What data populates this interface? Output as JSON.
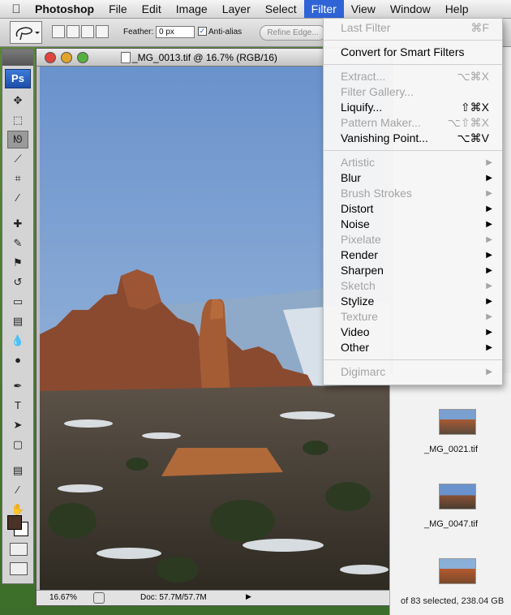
{
  "menubar": {
    "apple": "",
    "app_name": "Photoshop",
    "items": [
      "File",
      "Edit",
      "Image",
      "Layer",
      "Select",
      "Filter",
      "View",
      "Window",
      "Help"
    ],
    "active": "Filter"
  },
  "options_bar": {
    "feather_label": "Feather:",
    "feather_value": "0 px",
    "antialias_label": "Anti-alias",
    "antialias_checked": true,
    "refine_edge_label": "Refine Edge..."
  },
  "tools": {
    "logo": "Ps",
    "items": [
      {
        "name": "move-tool",
        "glyph": "✥"
      },
      {
        "name": "marquee-tool",
        "glyph": "⬚"
      },
      {
        "name": "lasso-tool",
        "glyph": "ᘚ",
        "selected": true
      },
      {
        "name": "quick-selection-tool",
        "glyph": "⟋"
      },
      {
        "name": "crop-tool",
        "glyph": "⌗"
      },
      {
        "name": "eyedropper-tool",
        "glyph": "⁄"
      },
      {
        "name": "healing-brush-tool",
        "glyph": "✚"
      },
      {
        "name": "brush-tool",
        "glyph": "✎"
      },
      {
        "name": "clone-stamp-tool",
        "glyph": "⚑"
      },
      {
        "name": "history-brush-tool",
        "glyph": "↺"
      },
      {
        "name": "eraser-tool",
        "glyph": "▭"
      },
      {
        "name": "gradient-tool",
        "glyph": "▤"
      },
      {
        "name": "blur-tool",
        "glyph": "💧"
      },
      {
        "name": "dodge-tool",
        "glyph": "●"
      },
      {
        "name": "pen-tool",
        "glyph": "✒"
      },
      {
        "name": "type-tool",
        "glyph": "T"
      },
      {
        "name": "path-selection-tool",
        "glyph": "➤"
      },
      {
        "name": "shape-tool",
        "glyph": "▢"
      },
      {
        "name": "notes-tool",
        "glyph": "▤"
      },
      {
        "name": "eyedropper-2-tool",
        "glyph": "⁄"
      },
      {
        "name": "hand-tool",
        "glyph": "✋"
      },
      {
        "name": "zoom-tool",
        "glyph": "🔍"
      }
    ],
    "foreground_color": "#4a3226",
    "background_color": "#ffffff"
  },
  "document": {
    "title": "_MG_0013.tif @ 16.7% (RGB/16)",
    "zoom": "16.67%",
    "doc_size": "Doc: 57.7M/57.7M"
  },
  "browser": {
    "thumbnails": [
      {
        "name": "_MG_0021.tif"
      },
      {
        "name": "_MG_0047.tif"
      }
    ],
    "selection_status": "of 83 selected, 238.04 GB"
  },
  "filter_menu": {
    "groups": [
      [
        {
          "label": "Last Filter",
          "shortcut": "⌘F",
          "disabled": true
        }
      ],
      [
        {
          "label": "Convert for Smart Filters",
          "disabled": false
        }
      ],
      [
        {
          "label": "Extract...",
          "shortcut": "⌥⌘X",
          "disabled": true
        },
        {
          "label": "Filter Gallery...",
          "disabled": true
        },
        {
          "label": "Liquify...",
          "shortcut": "⇧⌘X",
          "disabled": false
        },
        {
          "label": "Pattern Maker...",
          "shortcut": "⌥⇧⌘X",
          "disabled": true
        },
        {
          "label": "Vanishing Point...",
          "shortcut": "⌥⌘V",
          "disabled": false
        }
      ],
      [
        {
          "label": "Artistic",
          "submenu": true,
          "disabled": true
        },
        {
          "label": "Blur",
          "submenu": true,
          "disabled": false
        },
        {
          "label": "Brush Strokes",
          "submenu": true,
          "disabled": true
        },
        {
          "label": "Distort",
          "submenu": true,
          "disabled": false
        },
        {
          "label": "Noise",
          "submenu": true,
          "disabled": false
        },
        {
          "label": "Pixelate",
          "submenu": true,
          "disabled": true
        },
        {
          "label": "Render",
          "submenu": true,
          "disabled": false
        },
        {
          "label": "Sharpen",
          "submenu": true,
          "disabled": false
        },
        {
          "label": "Sketch",
          "submenu": true,
          "disabled": true
        },
        {
          "label": "Stylize",
          "submenu": true,
          "disabled": false
        },
        {
          "label": "Texture",
          "submenu": true,
          "disabled": true
        },
        {
          "label": "Video",
          "submenu": true,
          "disabled": false
        },
        {
          "label": "Other",
          "submenu": true,
          "disabled": false
        }
      ],
      [
        {
          "label": "Digimarc",
          "submenu": true,
          "disabled": true
        }
      ]
    ]
  }
}
